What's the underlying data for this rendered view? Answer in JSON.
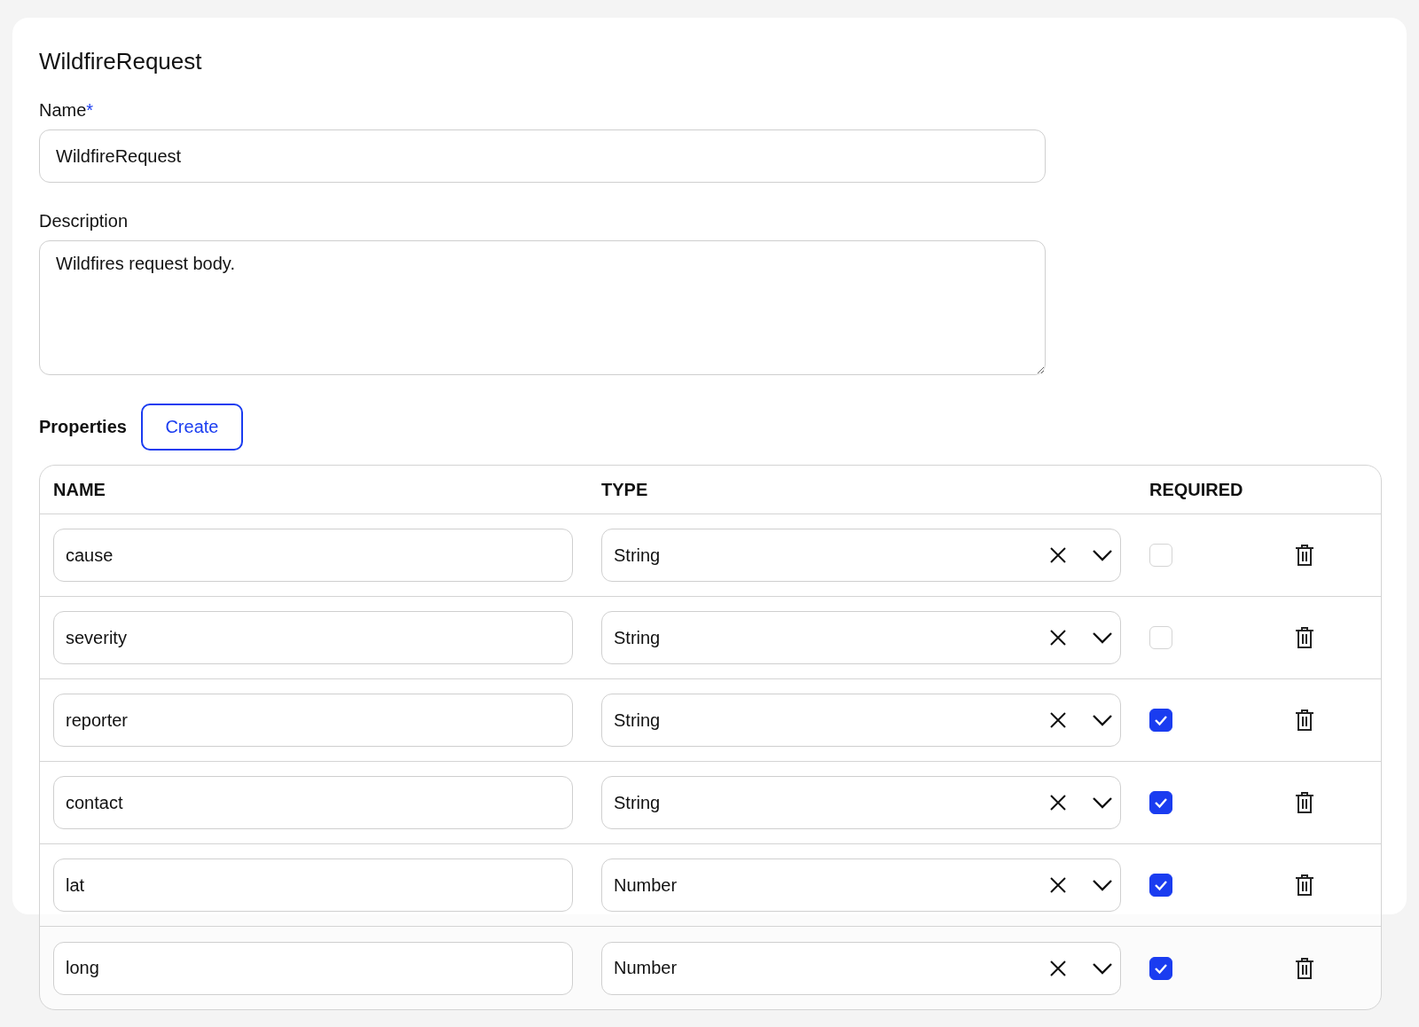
{
  "title": "WildfireRequest",
  "name_field": {
    "label": "Name",
    "required_mark": "*",
    "value": "WildfireRequest"
  },
  "description_field": {
    "label": "Description",
    "value": "Wildfires request body."
  },
  "properties": {
    "label": "Properties",
    "create_button": "Create"
  },
  "table": {
    "columns": [
      "NAME",
      "TYPE",
      "REQUIRED"
    ],
    "rows": [
      {
        "name": "cause",
        "type": "String",
        "required": false
      },
      {
        "name": "severity",
        "type": "String",
        "required": false
      },
      {
        "name": "reporter",
        "type": "String",
        "required": true
      },
      {
        "name": "contact",
        "type": "String",
        "required": true
      },
      {
        "name": "lat",
        "type": "Number",
        "required": true
      },
      {
        "name": "long",
        "type": "Number",
        "required": true
      }
    ]
  }
}
